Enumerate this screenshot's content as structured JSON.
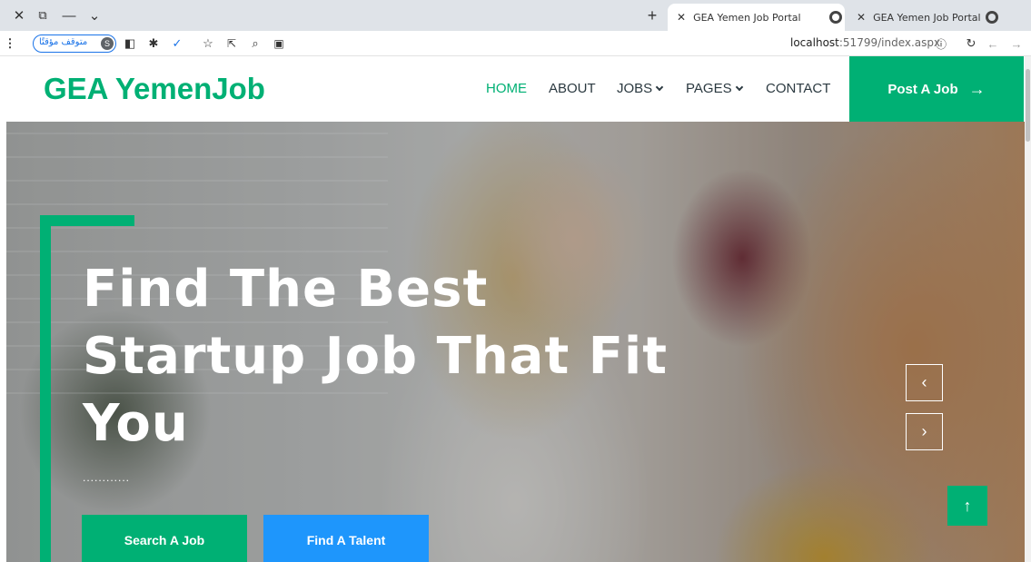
{
  "browser": {
    "window_controls": {
      "close": "✕",
      "restore": "⧉",
      "minimize": "—",
      "dropdown": "⌄"
    },
    "new_tab_label": "+",
    "tabs": [
      {
        "title": "GEA Yemen Job Portal",
        "active": true
      },
      {
        "title": "GEA Yemen Job Portal",
        "active": false
      }
    ],
    "profile_status": "متوقف مؤقتًا",
    "profile_initial": "S",
    "url_host": "localhost",
    "url_path": ":51799/index.aspx"
  },
  "site": {
    "logo": "GEA YemenJob",
    "nav": [
      {
        "label": "HOME",
        "active": true
      },
      {
        "label": "ABOUT",
        "active": false
      },
      {
        "label": "JOBS",
        "active": false,
        "dropdown": true
      },
      {
        "label": "PAGES",
        "active": false,
        "dropdown": true
      },
      {
        "label": "CONTACT",
        "active": false
      }
    ],
    "post_job_label": "Post A Job",
    "post_job_arrow": "→"
  },
  "hero": {
    "headline_line1": "Find The Best",
    "headline_line2": "Startup Job That Fit",
    "headline_line3": "You",
    "dots": "............",
    "search_button": "Search A Job",
    "talent_button": "Find A Talent",
    "prev_arrow": "‹",
    "next_arrow": "›",
    "back_to_top": "↑"
  },
  "colors": {
    "brand_green": "#00b074",
    "brand_blue": "#1e96fc",
    "nav_text": "#2b3940"
  }
}
